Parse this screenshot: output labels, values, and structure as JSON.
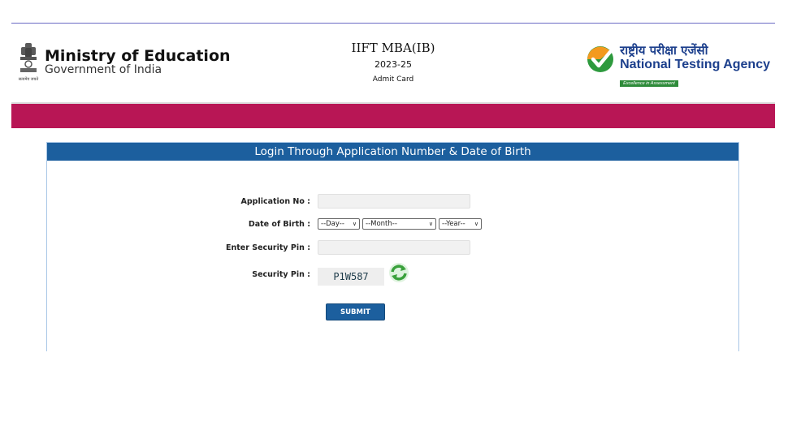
{
  "header": {
    "ministry_title": "Ministry of Education",
    "ministry_sub": "Government of India",
    "emblem_motto": "सत्यमेव जयते",
    "exam_name": "IIFT MBA(IB)",
    "session": "2023-25",
    "document": "Admit Card",
    "nta_hindi": "राष्ट्रीय परीक्षा एजेंसी",
    "nta_english": "National Testing Agency",
    "nta_tagline": "Excellence in Assessment"
  },
  "form": {
    "title": "Login Through Application Number & Date of Birth",
    "application_label": "Application No :",
    "application_value": "",
    "dob_label": "Date of Birth :",
    "day_value": "--Day--",
    "month_value": "--Month--",
    "year_value": "--Year--",
    "security_input_label": "Enter Security Pin :",
    "security_input_value": "",
    "security_pin_label": "Security Pin :",
    "captcha_text": "P1W587",
    "submit_label": "SUBMIT"
  },
  "colors": {
    "maroon_bar": "#b81655",
    "panel_header": "#1c5f9e",
    "nta_blue": "#1c3f8c",
    "refresh_green": "#3aa13c"
  },
  "icons": {
    "emblem": "national-emblem-icon",
    "nta_logo": "nta-check-logo",
    "refresh": "refresh-icon",
    "dropdown": "chevron-down-icon"
  }
}
